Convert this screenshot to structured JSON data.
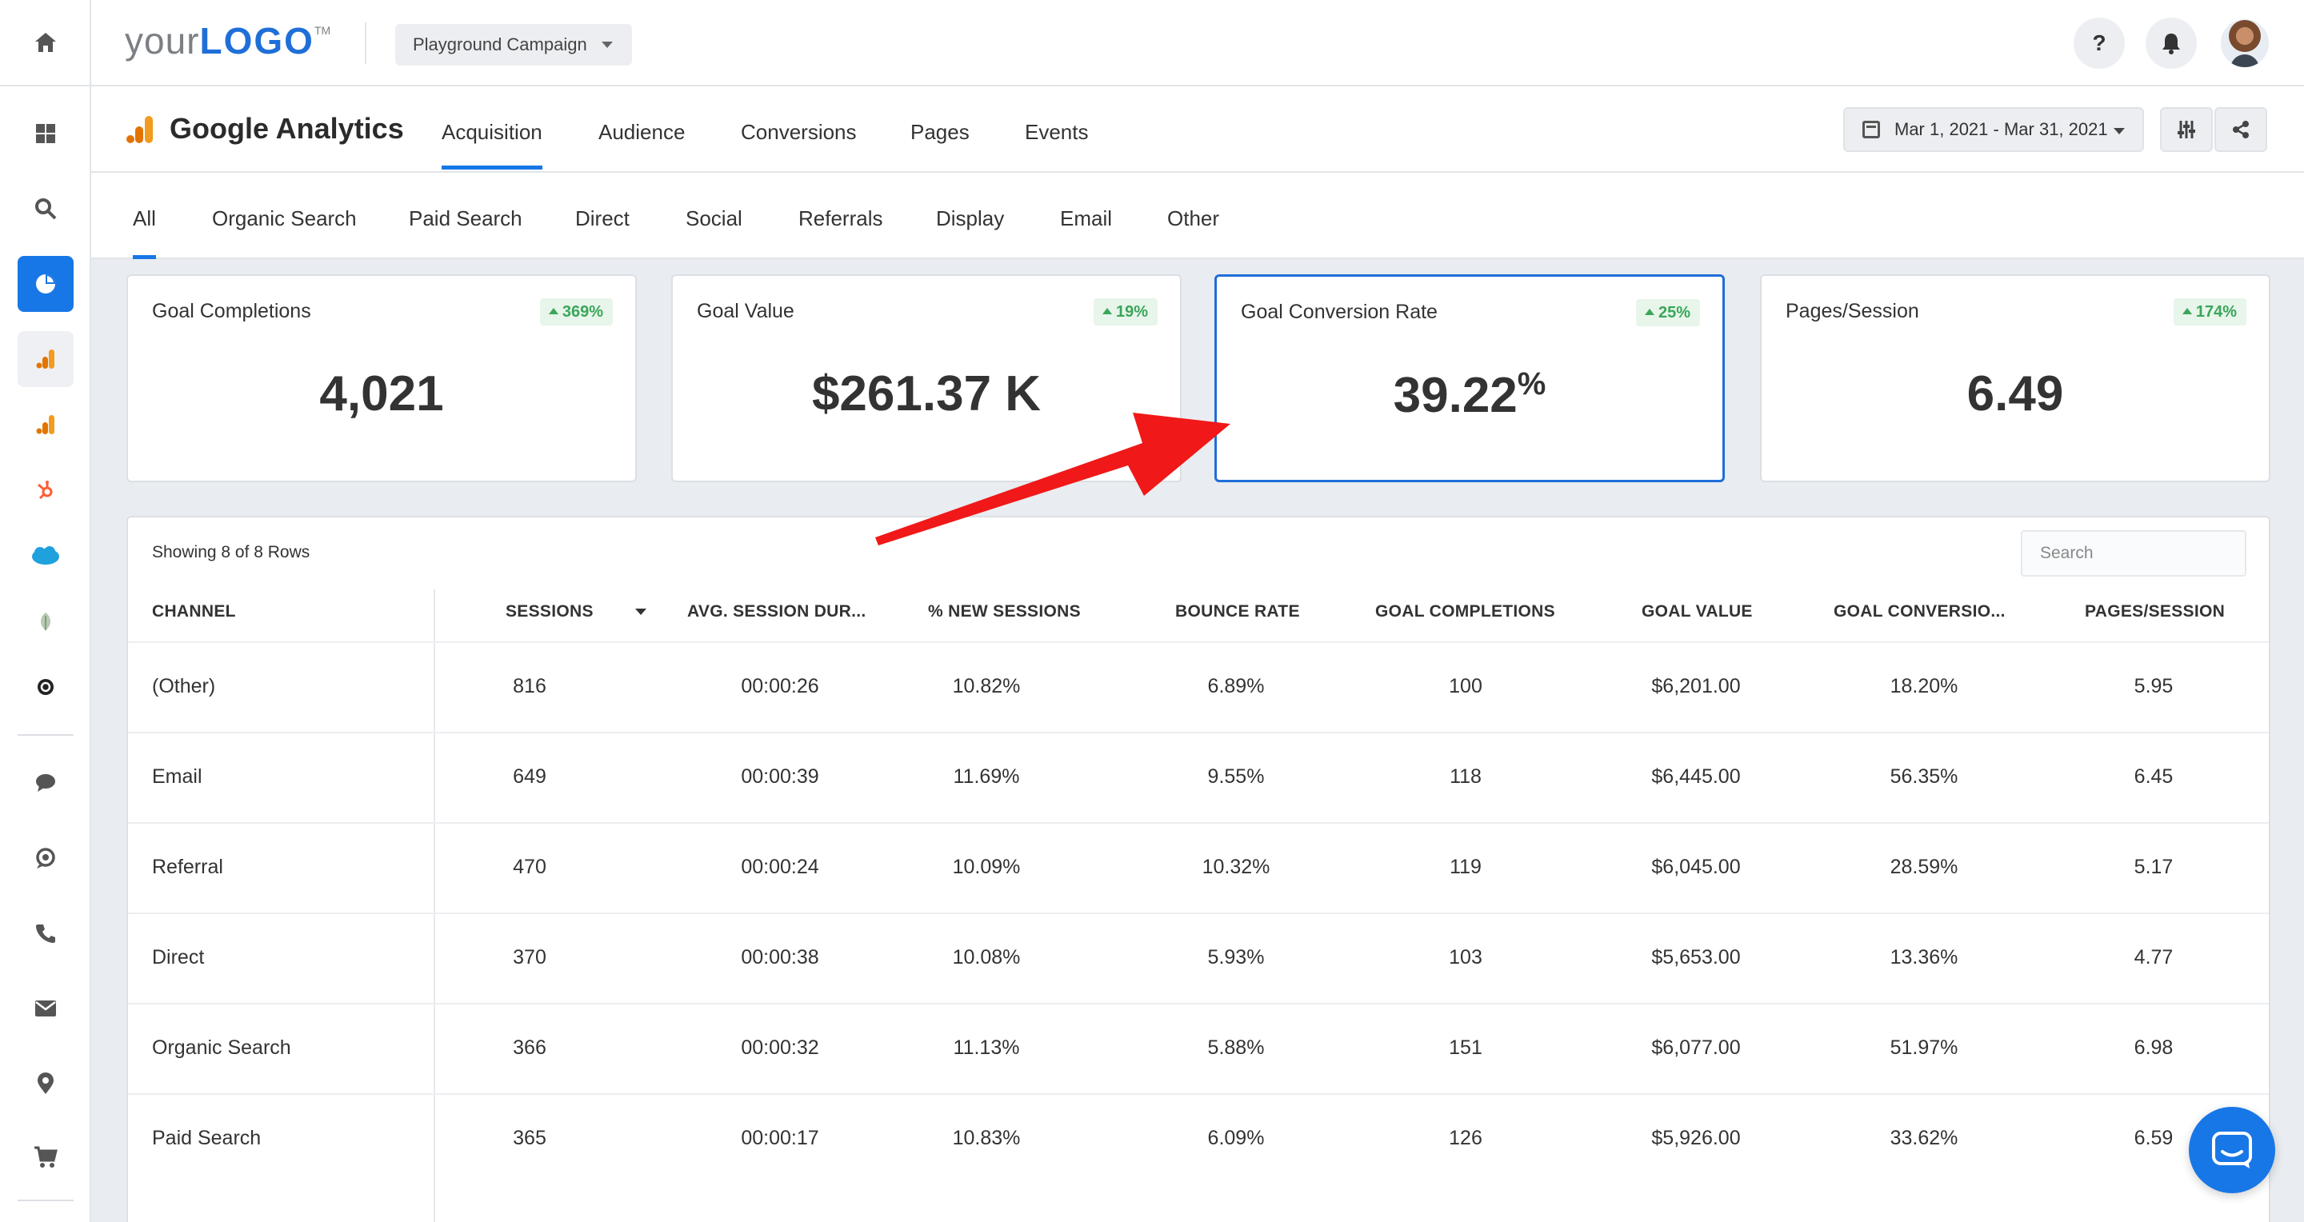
{
  "topbar": {
    "logo_your": "your",
    "logo_word": "LOGO",
    "logo_tm": "TM",
    "campaign": "Playground Campaign",
    "help_label": "?"
  },
  "section": {
    "title": "Google Analytics",
    "tabs": [
      {
        "label": "Acquisition",
        "active": true
      },
      {
        "label": "Audience",
        "active": false
      },
      {
        "label": "Conversions",
        "active": false
      },
      {
        "label": "Pages",
        "active": false
      },
      {
        "label": "Events",
        "active": false
      }
    ],
    "date_range": "Mar 1, 2021 - Mar 31, 2021"
  },
  "subtabs": [
    "All",
    "Organic Search",
    "Paid Search",
    "Direct",
    "Social",
    "Referrals",
    "Display",
    "Email",
    "Other"
  ],
  "kpis": [
    {
      "label": "Goal Completions",
      "change": "369%",
      "value": "4,021",
      "unit": ""
    },
    {
      "label": "Goal Value",
      "change": "19%",
      "value": "$261.37 K",
      "unit": ""
    },
    {
      "label": "Goal Conversion Rate",
      "change": "25%",
      "value": "39.22",
      "unit": "%"
    },
    {
      "label": "Pages/Session",
      "change": "174%",
      "value": "6.49",
      "unit": ""
    }
  ],
  "table": {
    "showing": "Showing 8 of 8 Rows",
    "search_placeholder": "Search",
    "headers": [
      "CHANNEL",
      "SESSIONS",
      "AVG. SESSION DUR...",
      "% NEW SESSIONS",
      "BOUNCE RATE",
      "GOAL COMPLETIONS",
      "GOAL VALUE",
      "GOAL CONVERSIO...",
      "PAGES/SESSION"
    ],
    "rows": [
      [
        "(Other)",
        "816",
        "00:00:26",
        "10.82%",
        "6.89%",
        "100",
        "$6,201.00",
        "18.20%",
        "5.95"
      ],
      [
        "Email",
        "649",
        "00:00:39",
        "11.69%",
        "9.55%",
        "118",
        "$6,445.00",
        "56.35%",
        "6.45"
      ],
      [
        "Referral",
        "470",
        "00:00:24",
        "10.09%",
        "10.32%",
        "119",
        "$6,045.00",
        "28.59%",
        "5.17"
      ],
      [
        "Direct",
        "370",
        "00:00:38",
        "10.08%",
        "5.93%",
        "103",
        "$5,653.00",
        "13.36%",
        "4.77"
      ],
      [
        "Organic Search",
        "366",
        "00:00:32",
        "11.13%",
        "5.88%",
        "151",
        "$6,077.00",
        "51.97%",
        "6.98"
      ],
      [
        "Paid Search",
        "365",
        "00:00:17",
        "10.83%",
        "6.09%",
        "126",
        "$5,926.00",
        "33.62%",
        "6.59"
      ]
    ]
  },
  "colors": {
    "accent": "#1877e6",
    "positive": "#3aa65a",
    "arrow": "#f01818"
  }
}
